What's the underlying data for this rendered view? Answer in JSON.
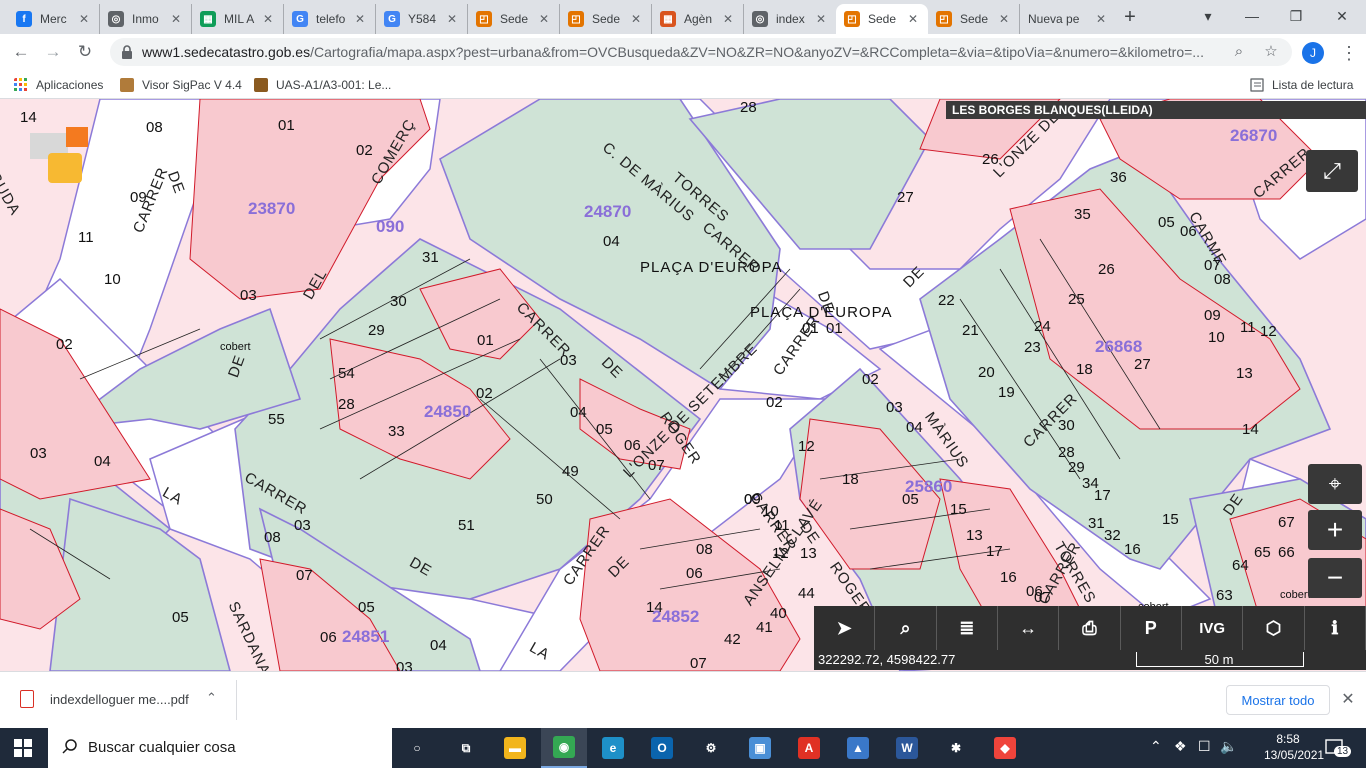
{
  "tabs": [
    {
      "label": "Merc",
      "icon": "facebook-icon",
      "color": "#1877f2",
      "glyph": "f"
    },
    {
      "label": "Inmo",
      "icon": "globe-icon",
      "color": "#5f6368",
      "glyph": "◎"
    },
    {
      "label": "MIL A",
      "icon": "sheets-icon",
      "color": "#0f9d58",
      "glyph": "▦"
    },
    {
      "label": "telefo",
      "icon": "google-icon",
      "color": "#4285f4",
      "glyph": "G"
    },
    {
      "label": "Y584",
      "icon": "google-icon",
      "color": "#4285f4",
      "glyph": "G"
    },
    {
      "label": "Sede",
      "icon": "catastro-icon",
      "color": "#e37400",
      "glyph": "◰"
    },
    {
      "label": "Sede",
      "icon": "catastro-icon",
      "color": "#e37400",
      "glyph": "◰"
    },
    {
      "label": "Agèn",
      "icon": "agencia-icon",
      "color": "#d9541e",
      "glyph": "▦"
    },
    {
      "label": "index",
      "icon": "globe-icon",
      "color": "#5f6368",
      "glyph": "◎"
    },
    {
      "label": "Sede",
      "icon": "catastro-icon",
      "color": "#e37400",
      "glyph": "◰"
    },
    {
      "label": "Sede",
      "icon": "catastro-icon",
      "color": "#e37400",
      "glyph": "◰"
    },
    {
      "label": "Nueva pe",
      "icon": "",
      "color": "",
      "glyph": ""
    }
  ],
  "tab_close_glyph": "✕",
  "new_tab_glyph": "+",
  "window_controls": {
    "minimize": "—",
    "maximize": "❐",
    "close": "✕",
    "tab_search": "▾"
  },
  "toolbar": {
    "back": "←",
    "forward": "→",
    "reload": "↻",
    "url_host": "www1.sedecatastro.gob.es",
    "url_path": "/Cartografia/mapa.aspx?pest=urbana&from=OVCBusqueda&ZV=NO&ZR=NO&anyoZV=&RCCompleta=&via=&tipoVia=&numero=&kilometro=...",
    "zoom_glyph": "⌕",
    "star_glyph": "☆",
    "profile_initial": "J",
    "menu_glyph": "⋮"
  },
  "bookmarks": [
    {
      "label": "Aplicaciones",
      "icon": "apps-grid-icon"
    },
    {
      "label": "Visor SigPac V 4.4",
      "icon": "sigpac-icon"
    },
    {
      "label": "UAS-A1/A3-001: Le...",
      "icon": "uas-icon"
    }
  ],
  "reading_list": "Lista de lectura",
  "map": {
    "title": "LES BORGES BLANQUES(LLEIDA)",
    "coordinates": "322292.72, 4598422.77",
    "scale_label": "50 m",
    "street_labels": [
      "LA",
      "CARRER",
      "DE",
      "LA",
      "SARDANA",
      "GUDA",
      "CARRER",
      "DE",
      "DEL",
      "COMERÇ",
      "C. DE MÀRIUS",
      "TORRES",
      "CARRER",
      "DE",
      "PLAÇA D'EUROPA",
      "PLAÇA D'EUROPA",
      "CARRER",
      "DE",
      "ROGER",
      "CARRER",
      "DE",
      "L'ONZE DE SETEMBRE",
      "CARRER",
      "DE",
      "CARRER",
      "DE",
      "ROGER",
      "L'ONZE DE",
      "CARME",
      "CARRER",
      "MÀRIUS",
      "TORRES",
      "DE",
      "CARRER",
      "DE",
      "ANSELM CLAVÉ",
      "CARRER",
      "DE"
    ],
    "block_ids": [
      "23870",
      "24870",
      "26870",
      "26868",
      "24850",
      "25860",
      "24851",
      "24852",
      "090"
    ],
    "parcel_numbers": [
      "14",
      "08",
      "01",
      "02",
      "09",
      "11",
      "10",
      "03",
      "02",
      "03",
      "04",
      "28",
      "27",
      "26",
      "04",
      "36",
      "35",
      "05",
      "06",
      "07",
      "08",
      "25",
      "26",
      "22",
      "21",
      "20",
      "19",
      "24",
      "23",
      "18",
      "27",
      "09",
      "10",
      "11",
      "12",
      "13",
      "14",
      "31",
      "30",
      "29",
      "01",
      "54",
      "28",
      "55",
      "33",
      "02",
      "03",
      "04",
      "05",
      "06",
      "07",
      "49",
      "50",
      "51",
      "03",
      "02",
      "01",
      "01",
      "02",
      "03",
      "04",
      "12",
      "18",
      "05",
      "15",
      "13",
      "17",
      "16",
      "06",
      "07",
      "09",
      "10",
      "11",
      "12",
      "13",
      "08",
      "06",
      "44",
      "40",
      "41",
      "42",
      "14",
      "07",
      "30",
      "28",
      "29",
      "34",
      "17",
      "31",
      "32",
      "16",
      "15",
      "67",
      "65",
      "66",
      "64",
      "63",
      "08",
      "07",
      "05",
      "06",
      "04",
      "03",
      "05",
      "09",
      "63",
      "50",
      "19"
    ],
    "annotations": [
      "cobert",
      "cobert",
      "cobert"
    ]
  },
  "map_tools": [
    {
      "name": "select-tool",
      "glyph": "➤"
    },
    {
      "name": "search-tool",
      "glyph": "⌕"
    },
    {
      "name": "layers-tool",
      "glyph": "≣"
    },
    {
      "name": "measure-tool",
      "glyph": "↔"
    },
    {
      "name": "print-tool",
      "glyph": "⎙"
    },
    {
      "name": "parcel-tool",
      "glyph": "P"
    },
    {
      "name": "ivg-tool",
      "glyph": "IVG"
    },
    {
      "name": "layers3d-tool",
      "glyph": "⬡"
    },
    {
      "name": "info-tool",
      "glyph": "ℹ"
    }
  ],
  "map_controls": {
    "fullscreen": "⤢",
    "center": "⌖",
    "zoom_in": "+",
    "zoom_out": "−"
  },
  "download": {
    "filename": "indexdelloguer me....pdf",
    "chevron": "⌃",
    "show_all": "Mostrar todo",
    "close": "✕"
  },
  "taskbar": {
    "search_placeholder": "Buscar cualquier cosa",
    "apps": [
      {
        "name": "cortana-button",
        "glyph": "○",
        "color": "transparent"
      },
      {
        "name": "task-view-button",
        "glyph": "⧉",
        "color": "transparent"
      },
      {
        "name": "file-explorer-button",
        "glyph": "▬",
        "color": "#f2b51c"
      },
      {
        "name": "chrome-button",
        "glyph": "◉",
        "color": "#34a853"
      },
      {
        "name": "edge-button",
        "glyph": "e",
        "color": "#1e90c8"
      },
      {
        "name": "outlook-button",
        "glyph": "O",
        "color": "#0a64ad"
      },
      {
        "name": "settings-button",
        "glyph": "⚙",
        "color": "transparent"
      },
      {
        "name": "remote-desktop-button",
        "glyph": "▣",
        "color": "#4a8fd6"
      },
      {
        "name": "acrobat-button",
        "glyph": "A",
        "color": "#e03124"
      },
      {
        "name": "photos-button",
        "glyph": "▲",
        "color": "#3a78c8"
      },
      {
        "name": "word-button",
        "glyph": "W",
        "color": "#2b579a"
      },
      {
        "name": "slack-button",
        "glyph": "✱",
        "color": "transparent"
      },
      {
        "name": "anydesk-button",
        "glyph": "◆",
        "color": "#ef443b"
      }
    ],
    "tray": {
      "chevron": "⌃",
      "dropbox": "❖",
      "network": "☐",
      "volume": "🔈"
    },
    "time": "8:58",
    "date": "13/05/2021",
    "notifications": "13"
  }
}
